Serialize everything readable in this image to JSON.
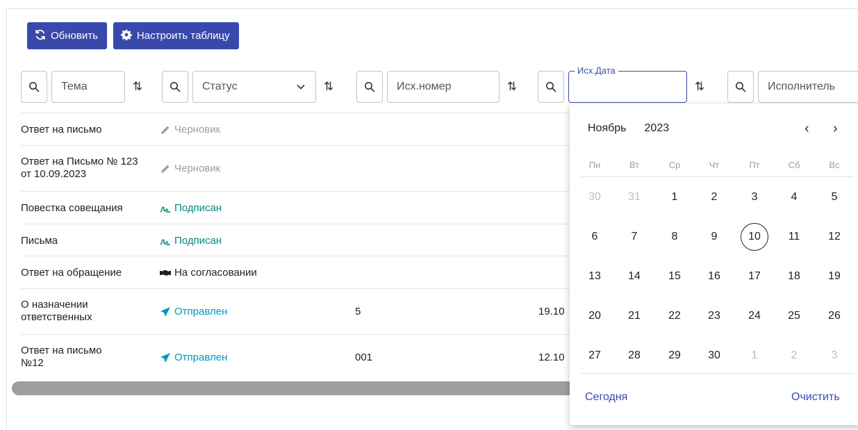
{
  "toolbar": {
    "refresh_label": "Обновить",
    "configure_label": "Настроить таблицу",
    "button_color": "#3949ab"
  },
  "filters": {
    "subject_placeholder": "Тема",
    "status_placeholder": "Статус",
    "outnum_placeholder": "Исх.номер",
    "outdate_label": "Исх.Дата",
    "executor_placeholder": "Исполнитель"
  },
  "rows": [
    {
      "subject": "Ответ на письмо",
      "status": "Черновик",
      "status_icon": "pencil-icon",
      "number": "",
      "date": ""
    },
    {
      "subject": "Ответ на Письмо № 123 от 10.09.2023",
      "status": "Черновик",
      "status_icon": "pencil-icon",
      "number": "",
      "date": ""
    },
    {
      "subject": "Повестка совещания",
      "status": "Подписан",
      "status_icon": "signature-icon",
      "number": "",
      "date": ""
    },
    {
      "subject": "Письма",
      "status": "Подписан",
      "status_icon": "signature-icon",
      "number": "",
      "date": ""
    },
    {
      "subject": "Ответ на обращение",
      "status": "На согласовании",
      "status_icon": "handshake-icon",
      "number": "",
      "date": ""
    },
    {
      "subject": "О назначении ответственных",
      "status": "Отправлен",
      "status_icon": "paper-plane-icon",
      "number": "5",
      "date": "19.10"
    },
    {
      "subject": "Ответ на письмо №12",
      "status": "Отправлен",
      "status_icon": "paper-plane-icon",
      "number": "001",
      "date": "12.10"
    }
  ],
  "calendar": {
    "month": "Ноябрь",
    "year": "2023",
    "weekdays": [
      "Пн",
      "Вт",
      "Ср",
      "Чт",
      "Пт",
      "Сб",
      "Вс"
    ],
    "weeks": [
      [
        "30",
        "31",
        "1",
        "2",
        "3",
        "4",
        "5"
      ],
      [
        "6",
        "7",
        "8",
        "9",
        "10",
        "11",
        "12"
      ],
      [
        "13",
        "14",
        "15",
        "16",
        "17",
        "18",
        "19"
      ],
      [
        "20",
        "21",
        "22",
        "23",
        "24",
        "25",
        "26"
      ],
      [
        "27",
        "28",
        "29",
        "30",
        "1",
        "2",
        "3"
      ]
    ],
    "today": "10",
    "today_label": "Сегодня",
    "clear_label": "Очистить"
  }
}
